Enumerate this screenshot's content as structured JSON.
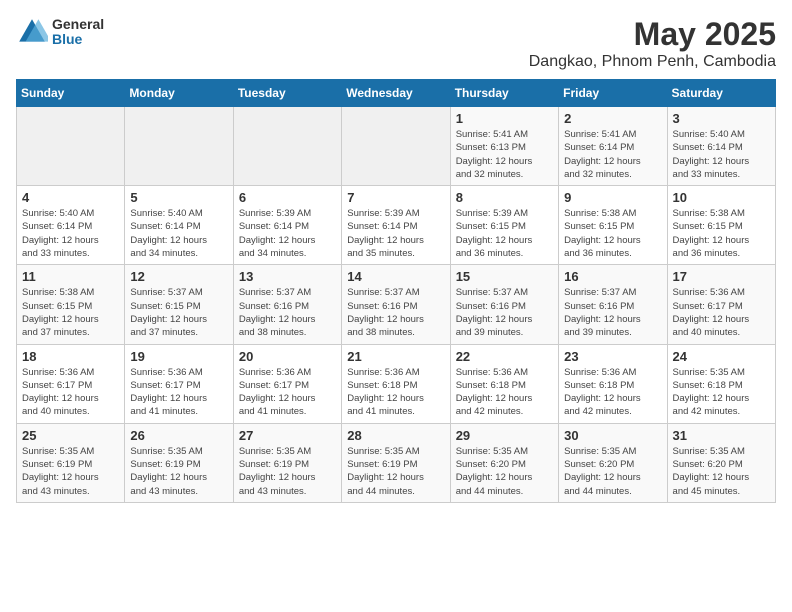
{
  "header": {
    "logo_general": "General",
    "logo_blue": "Blue",
    "month_title": "May 2025",
    "location": "Dangkao, Phnom Penh, Cambodia"
  },
  "weekdays": [
    "Sunday",
    "Monday",
    "Tuesday",
    "Wednesday",
    "Thursday",
    "Friday",
    "Saturday"
  ],
  "weeks": [
    [
      {
        "day": "",
        "info": ""
      },
      {
        "day": "",
        "info": ""
      },
      {
        "day": "",
        "info": ""
      },
      {
        "day": "",
        "info": ""
      },
      {
        "day": "1",
        "info": "Sunrise: 5:41 AM\nSunset: 6:13 PM\nDaylight: 12 hours\nand 32 minutes."
      },
      {
        "day": "2",
        "info": "Sunrise: 5:41 AM\nSunset: 6:14 PM\nDaylight: 12 hours\nand 32 minutes."
      },
      {
        "day": "3",
        "info": "Sunrise: 5:40 AM\nSunset: 6:14 PM\nDaylight: 12 hours\nand 33 minutes."
      }
    ],
    [
      {
        "day": "4",
        "info": "Sunrise: 5:40 AM\nSunset: 6:14 PM\nDaylight: 12 hours\nand 33 minutes."
      },
      {
        "day": "5",
        "info": "Sunrise: 5:40 AM\nSunset: 6:14 PM\nDaylight: 12 hours\nand 34 minutes."
      },
      {
        "day": "6",
        "info": "Sunrise: 5:39 AM\nSunset: 6:14 PM\nDaylight: 12 hours\nand 34 minutes."
      },
      {
        "day": "7",
        "info": "Sunrise: 5:39 AM\nSunset: 6:14 PM\nDaylight: 12 hours\nand 35 minutes."
      },
      {
        "day": "8",
        "info": "Sunrise: 5:39 AM\nSunset: 6:15 PM\nDaylight: 12 hours\nand 36 minutes."
      },
      {
        "day": "9",
        "info": "Sunrise: 5:38 AM\nSunset: 6:15 PM\nDaylight: 12 hours\nand 36 minutes."
      },
      {
        "day": "10",
        "info": "Sunrise: 5:38 AM\nSunset: 6:15 PM\nDaylight: 12 hours\nand 36 minutes."
      }
    ],
    [
      {
        "day": "11",
        "info": "Sunrise: 5:38 AM\nSunset: 6:15 PM\nDaylight: 12 hours\nand 37 minutes."
      },
      {
        "day": "12",
        "info": "Sunrise: 5:37 AM\nSunset: 6:15 PM\nDaylight: 12 hours\nand 37 minutes."
      },
      {
        "day": "13",
        "info": "Sunrise: 5:37 AM\nSunset: 6:16 PM\nDaylight: 12 hours\nand 38 minutes."
      },
      {
        "day": "14",
        "info": "Sunrise: 5:37 AM\nSunset: 6:16 PM\nDaylight: 12 hours\nand 38 minutes."
      },
      {
        "day": "15",
        "info": "Sunrise: 5:37 AM\nSunset: 6:16 PM\nDaylight: 12 hours\nand 39 minutes."
      },
      {
        "day": "16",
        "info": "Sunrise: 5:37 AM\nSunset: 6:16 PM\nDaylight: 12 hours\nand 39 minutes."
      },
      {
        "day": "17",
        "info": "Sunrise: 5:36 AM\nSunset: 6:17 PM\nDaylight: 12 hours\nand 40 minutes."
      }
    ],
    [
      {
        "day": "18",
        "info": "Sunrise: 5:36 AM\nSunset: 6:17 PM\nDaylight: 12 hours\nand 40 minutes."
      },
      {
        "day": "19",
        "info": "Sunrise: 5:36 AM\nSunset: 6:17 PM\nDaylight: 12 hours\nand 41 minutes."
      },
      {
        "day": "20",
        "info": "Sunrise: 5:36 AM\nSunset: 6:17 PM\nDaylight: 12 hours\nand 41 minutes."
      },
      {
        "day": "21",
        "info": "Sunrise: 5:36 AM\nSunset: 6:18 PM\nDaylight: 12 hours\nand 41 minutes."
      },
      {
        "day": "22",
        "info": "Sunrise: 5:36 AM\nSunset: 6:18 PM\nDaylight: 12 hours\nand 42 minutes."
      },
      {
        "day": "23",
        "info": "Sunrise: 5:36 AM\nSunset: 6:18 PM\nDaylight: 12 hours\nand 42 minutes."
      },
      {
        "day": "24",
        "info": "Sunrise: 5:35 AM\nSunset: 6:18 PM\nDaylight: 12 hours\nand 42 minutes."
      }
    ],
    [
      {
        "day": "25",
        "info": "Sunrise: 5:35 AM\nSunset: 6:19 PM\nDaylight: 12 hours\nand 43 minutes."
      },
      {
        "day": "26",
        "info": "Sunrise: 5:35 AM\nSunset: 6:19 PM\nDaylight: 12 hours\nand 43 minutes."
      },
      {
        "day": "27",
        "info": "Sunrise: 5:35 AM\nSunset: 6:19 PM\nDaylight: 12 hours\nand 43 minutes."
      },
      {
        "day": "28",
        "info": "Sunrise: 5:35 AM\nSunset: 6:19 PM\nDaylight: 12 hours\nand 44 minutes."
      },
      {
        "day": "29",
        "info": "Sunrise: 5:35 AM\nSunset: 6:20 PM\nDaylight: 12 hours\nand 44 minutes."
      },
      {
        "day": "30",
        "info": "Sunrise: 5:35 AM\nSunset: 6:20 PM\nDaylight: 12 hours\nand 44 minutes."
      },
      {
        "day": "31",
        "info": "Sunrise: 5:35 AM\nSunset: 6:20 PM\nDaylight: 12 hours\nand 45 minutes."
      }
    ]
  ]
}
